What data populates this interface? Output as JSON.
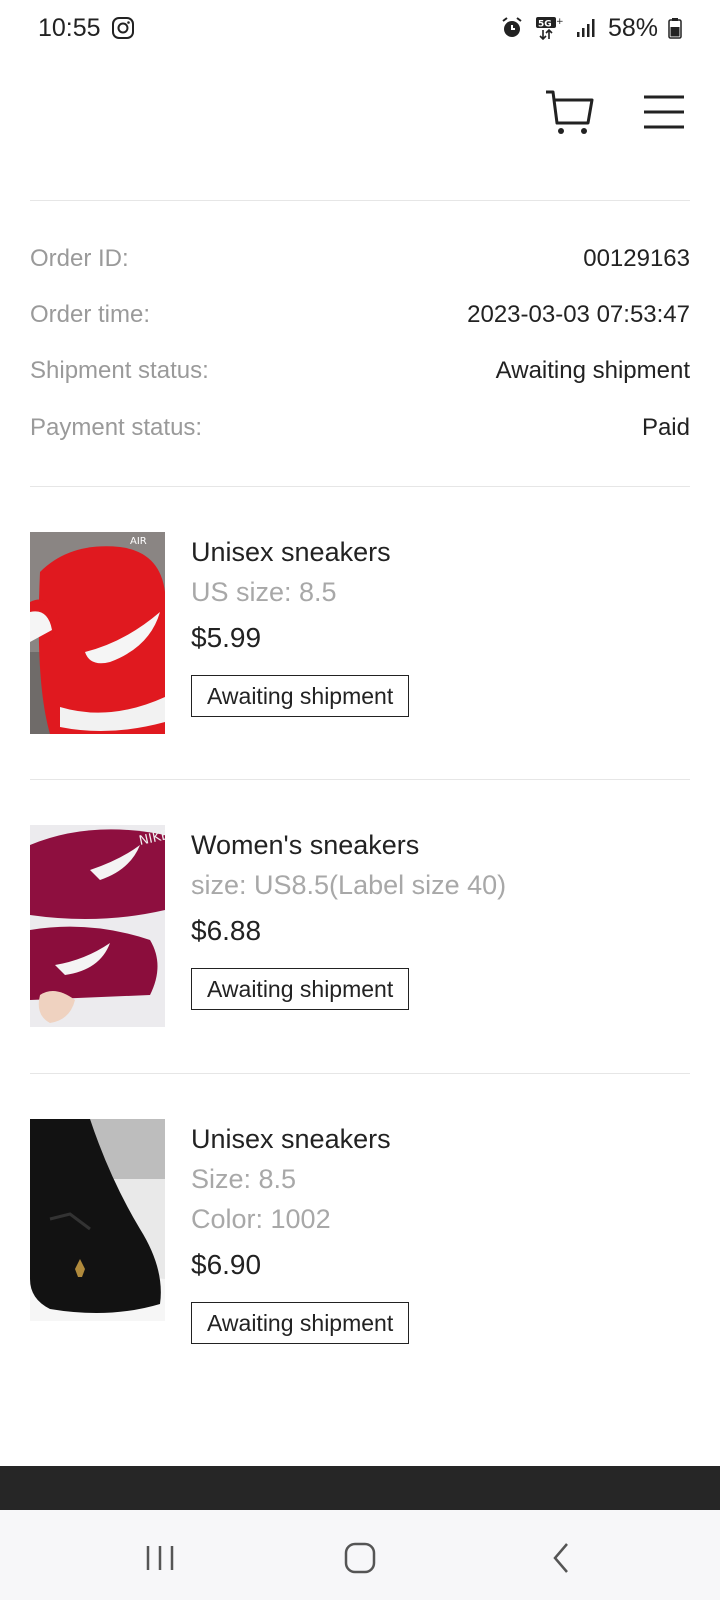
{
  "status_bar": {
    "time": "10:55",
    "battery": "58%",
    "icons": [
      "instagram-icon",
      "alarm-icon",
      "5g-icon",
      "signal-icon",
      "battery-icon"
    ]
  },
  "header": {
    "icons": [
      "cart-icon",
      "menu-icon"
    ]
  },
  "order": {
    "id_label": "Order ID:",
    "id_value": "00129163",
    "time_label": "Order time:",
    "time_value": "2023-03-03 07:53:47",
    "shipment_label": "Shipment status:",
    "shipment_value": "Awaiting shipment",
    "payment_label": "Payment status:",
    "payment_value": "Paid"
  },
  "items": [
    {
      "name": "Unisex sneakers",
      "attrs": [
        "US size: 8.5"
      ],
      "price": "$5.99",
      "status": "Awaiting shipment",
      "image": "red-sneaker-image"
    },
    {
      "name": "Women's sneakers",
      "attrs": [
        "size: US8.5(Label size 40)"
      ],
      "price": "$6.88",
      "status": "Awaiting shipment",
      "image": "burgundy-sneaker-image"
    },
    {
      "name": "Unisex sneakers",
      "attrs": [
        "Size: 8.5",
        "Color: 1002"
      ],
      "price": "$6.90",
      "status": "Awaiting shipment",
      "image": "black-sneaker-image"
    }
  ],
  "nav": {
    "icons": [
      "recent-apps-icon",
      "home-icon",
      "back-icon"
    ]
  },
  "colors": {
    "text": "#222222",
    "muted": "#9a9a9a",
    "divider": "#e6e6e6",
    "footer": "#262626"
  }
}
